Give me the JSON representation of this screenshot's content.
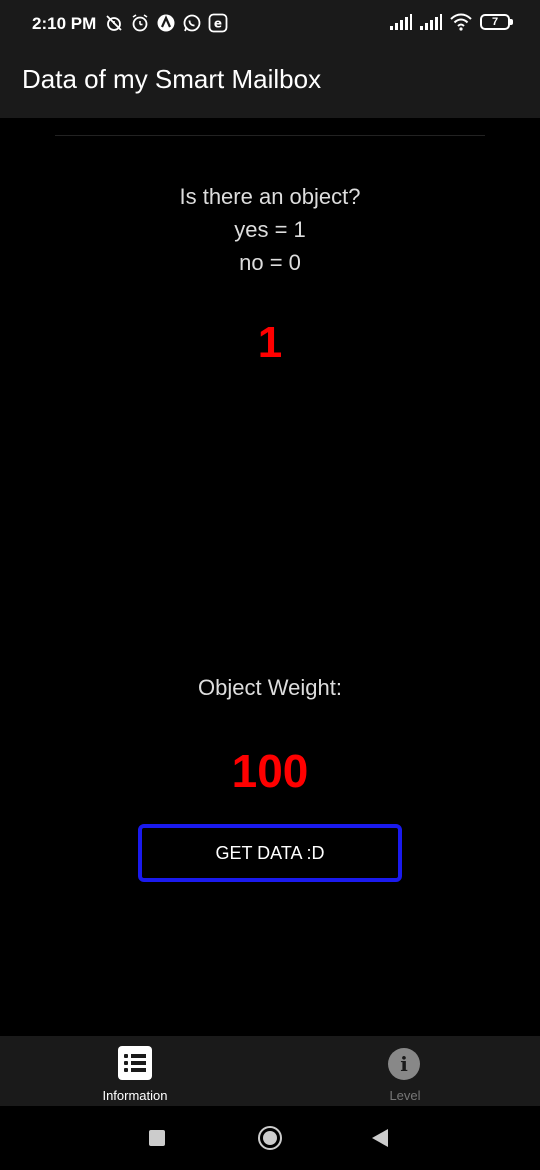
{
  "status_bar": {
    "time": "2:10 PM",
    "battery_level": "7",
    "left_icons": [
      "alarm-off-icon",
      "alarm-clock-icon",
      "arc-launcher-icon",
      "whatsapp-icon",
      "e-app-icon"
    ],
    "right_icons": [
      "signal-1-icon",
      "signal-2-icon",
      "wifi-icon",
      "battery-icon"
    ]
  },
  "app_bar": {
    "title": "Data of my Smart Mailbox"
  },
  "content": {
    "question_line1": "Is there an object?",
    "question_line2": "yes = 1",
    "question_line3": "no = 0",
    "object_value": "1",
    "weight_label": "Object Weight:",
    "weight_value": "100",
    "button_label": "GET DATA :D"
  },
  "bottom_nav": {
    "items": [
      {
        "label": "Information",
        "icon": "list-icon",
        "active": true
      },
      {
        "label": "Level",
        "icon": "info-icon",
        "active": false
      }
    ]
  },
  "system_nav": {
    "buttons": [
      "recent-apps-button",
      "home-button",
      "back-button"
    ]
  },
  "colors": {
    "background": "#000000",
    "bars": "#1a1a1a",
    "value_red": "#ff0000",
    "button_border": "#1a1aee",
    "text": "#dddddd"
  }
}
